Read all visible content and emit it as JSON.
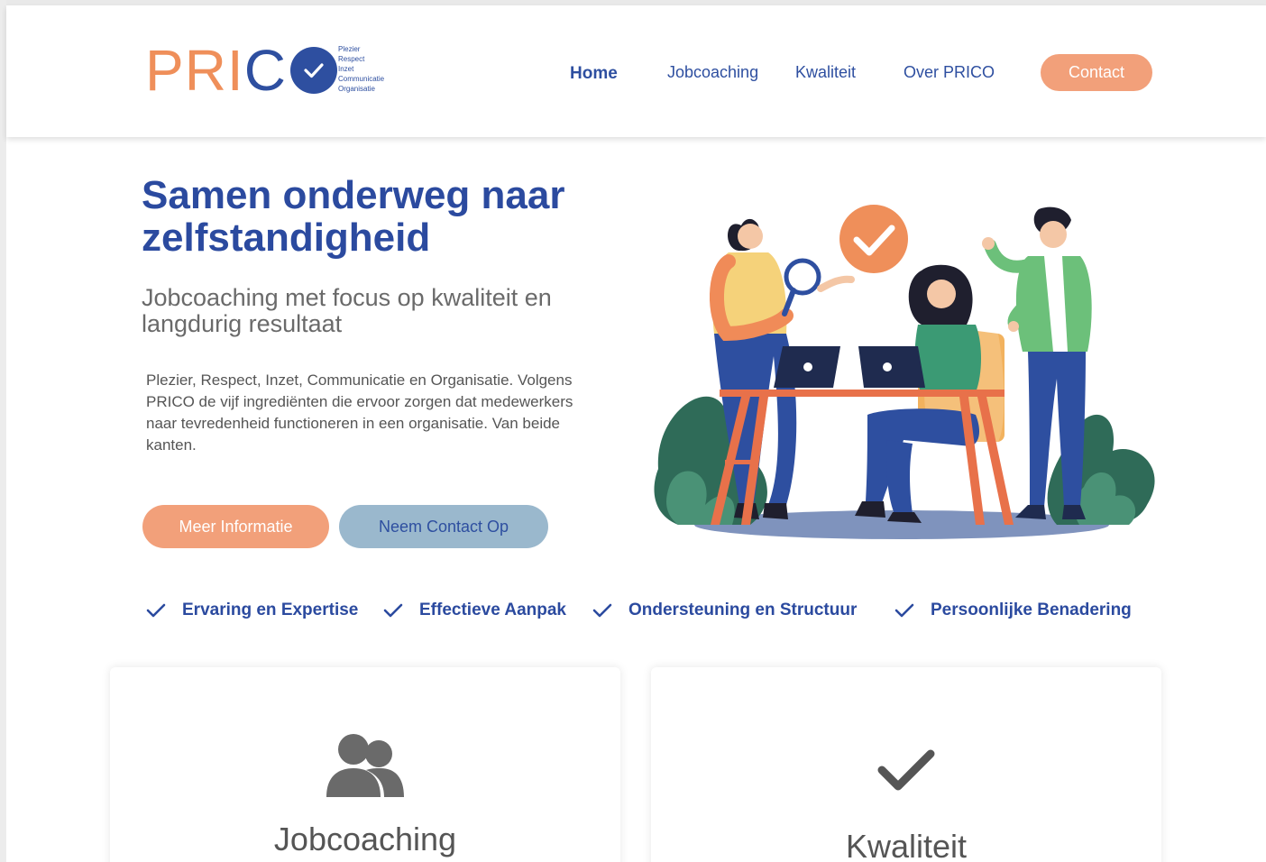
{
  "logo": {
    "word_pri": "PRI",
    "word_c": "C",
    "values": [
      "Plezier",
      "Respect",
      "Inzet",
      "Communicatie",
      "Organisatie"
    ]
  },
  "nav": {
    "items": [
      {
        "label": "Home",
        "active": true
      },
      {
        "label": "Jobcoaching",
        "active": false
      },
      {
        "label": "Kwaliteit",
        "active": false
      },
      {
        "label": "Over PRICO",
        "active": false
      }
    ],
    "contact_label": "Contact"
  },
  "hero": {
    "title": "Samen onderweg naar zelfstandigheid",
    "subtitle": "Jobcoaching met focus op kwaliteit en langdurig resultaat",
    "body": "Plezier, Respect, Inzet, Communicatie en Organisatie. Volgens PRICO de vijf ingrediënten die ervoor zorgen dat medewerkers naar tevredenheid functioneren in een organisatie. Van beide kanten.",
    "primary_button": "Meer Informatie",
    "secondary_button": "Neem Contact Op"
  },
  "features": [
    {
      "label": "Ervaring en Expertise",
      "icon": "check-icon"
    },
    {
      "label": "Effectieve Aanpak",
      "icon": "check-icon"
    },
    {
      "label": "Ondersteuning en Structuur",
      "icon": "check-icon"
    },
    {
      "label": "Persoonlijke Benadering",
      "icon": "check-icon"
    }
  ],
  "cards": [
    {
      "title": "Jobcoaching",
      "icon": "users-icon"
    },
    {
      "title": "Kwaliteit",
      "icon": "check-icon"
    }
  ],
  "colors": {
    "brand_blue": "#2e4fa0",
    "brand_orange": "#f2a07a",
    "button_secondary": "#9ab8cd"
  }
}
